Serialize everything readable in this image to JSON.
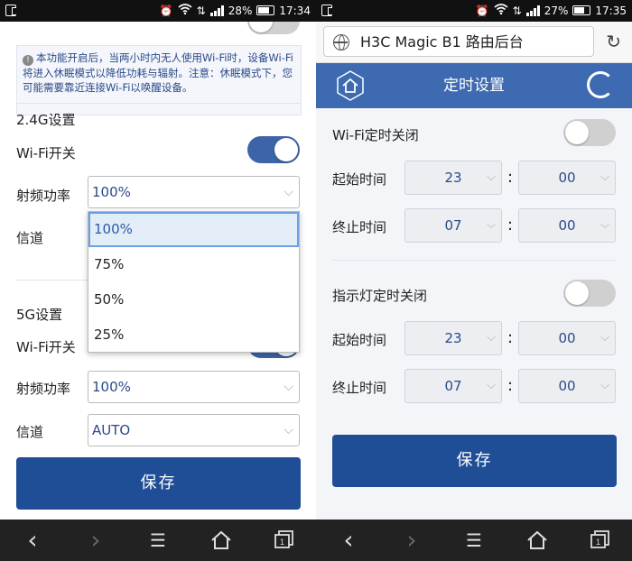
{
  "left": {
    "status": {
      "battery": "28%",
      "time": "17:34"
    },
    "notice": "本功能开启后，当两小时内无人使用Wi-Fi时，设备Wi-Fi将进入休眠模式以降低功耗与辐射。注意：休眠模式下，您可能需要靠近连接Wi-Fi以唤醒设备。",
    "section_24g": {
      "title": "2.4G设置",
      "wifi_label": "Wi-Fi开关",
      "wifi_on": true,
      "power_label": "射频功率",
      "power_value": "100%",
      "channel_label": "信道"
    },
    "dropdown": [
      "100%",
      "75%",
      "50%",
      "25%"
    ],
    "dropdown_selected": "100%",
    "section_5g": {
      "title": "5G设置",
      "wifi_label": "Wi-Fi开关",
      "power_label": "射频功率",
      "power_value": "100%",
      "channel_label": "信道",
      "channel_value": "AUTO"
    },
    "save_label": "保存"
  },
  "right": {
    "status": {
      "battery": "27%",
      "time": "17:35"
    },
    "url": "H3C Magic B1 路由后台",
    "page_title": "定时设置",
    "wifi_timer": {
      "label": "Wi-Fi定时关闭",
      "enabled": false,
      "start_label": "起始时间",
      "start_hour": "23",
      "start_min": "00",
      "end_label": "终止时间",
      "end_hour": "07",
      "end_min": "00"
    },
    "led_timer": {
      "label": "指示灯定时关闭",
      "enabled": false,
      "start_label": "起始时间",
      "start_hour": "23",
      "start_min": "00",
      "end_label": "终止时间",
      "end_hour": "07",
      "end_min": "00"
    },
    "colon": ":",
    "save_label": "保存"
  },
  "icons": {
    "chevron": "⌵",
    "back": "‹",
    "forward": "›",
    "menu": "☰",
    "reload": "↻"
  },
  "colors": {
    "accent": "#1f4e96",
    "header": "#3d6ab0",
    "toggle_on": "#3d64a8"
  }
}
